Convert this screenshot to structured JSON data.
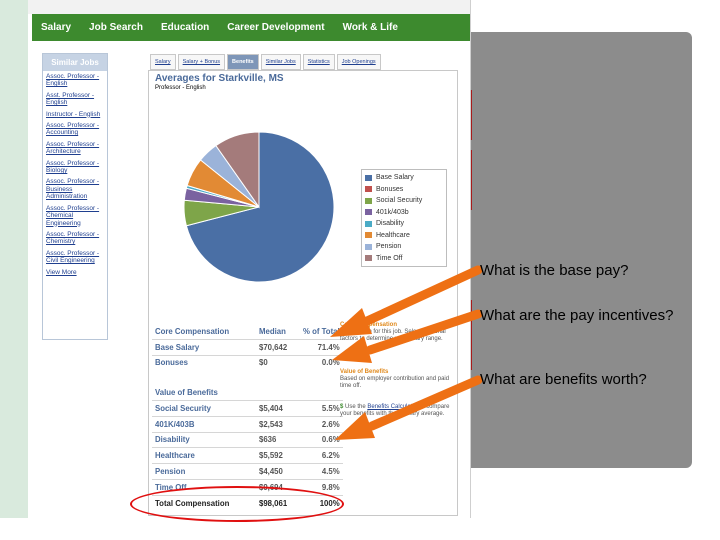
{
  "nav": {
    "items": [
      "Salary",
      "Job Search",
      "Education",
      "Career Development",
      "Work & Life"
    ]
  },
  "sidebar": {
    "heading": "Similar Jobs",
    "links": [
      "Assoc. Professor - English",
      "Asst. Professor - English",
      "Instructor - English",
      "Assoc. Professor - Accounting",
      "Assoc. Professor - Architecture",
      "Assoc. Professor - Biology",
      "Assoc. Professor - Business Administration",
      "Assoc. Professor - Chemical Engineering",
      "Assoc. Professor - Chemistry",
      "Assoc. Professor - Civil Engineering",
      "View More"
    ]
  },
  "tabs": [
    "Salary",
    "Salary + Bonus",
    "Benefits",
    "Similar Jobs",
    "Statistics",
    "Job Openings"
  ],
  "active_tab": "Benefits",
  "content": {
    "title": "Averages for Starkville, MS",
    "subtitle": "Professor - English"
  },
  "chart_data": {
    "type": "pie",
    "categories": [
      "Base Salary",
      "Bonuses",
      "Social Security",
      "401k/403b",
      "Disability",
      "Healthcare",
      "Pension",
      "Time Off"
    ],
    "values": [
      71.4,
      0.0,
      5.5,
      2.6,
      0.6,
      6.2,
      4.5,
      9.8
    ],
    "colors": [
      "#4a6fa5",
      "#c0504d",
      "#7ea549",
      "#7a62a0",
      "#4babc6",
      "#e28a34",
      "#9bb3d9",
      "#a47b7b"
    ],
    "legend_position": "right"
  },
  "table": {
    "columns": [
      "Core Compensation",
      "Median",
      "% of Total"
    ],
    "core_rows": [
      {
        "label": "Base Salary",
        "median": "$70,642",
        "pct": "71.4%"
      },
      {
        "label": "Bonuses",
        "median": "$0",
        "pct": "0.0%"
      }
    ],
    "benefits_heading": "Value of Benefits",
    "benefit_rows": [
      {
        "label": "Social Security",
        "median": "$5,404",
        "pct": "5.5%"
      },
      {
        "label": "401K/403B",
        "median": "$2,543",
        "pct": "2.6%"
      },
      {
        "label": "Disability",
        "median": "$636",
        "pct": "0.6%"
      },
      {
        "label": "Healthcare",
        "median": "$5,592",
        "pct": "6.2%"
      },
      {
        "label": "Pension",
        "median": "$4,450",
        "pct": "4.5%"
      },
      {
        "label": "Time Off",
        "median": "$9,694",
        "pct": "9.8%"
      }
    ],
    "total": {
      "label": "Total Compensation",
      "median": "$98,061",
      "pct": "100%"
    }
  },
  "notes": {
    "core_head": "Core Compensation",
    "core_text": "The median for this job. Select personal factors to determine your salary range.",
    "benefits_head": "Value of Benefits",
    "benefits_text": "Based on employer contribution and paid time off.",
    "calc_prefix": "Use the",
    "calc_link": "Benefits Calculator",
    "calc_text": "to compare your benefits with the industry average."
  },
  "questions": [
    "What is the base pay?",
    "What are the pay incentives?",
    "What are benefits worth?"
  ],
  "accent_colors": {
    "nav_green": "#3d8a2e",
    "arrow_orange": "#ee7014",
    "highlight_red": "#e01010"
  }
}
